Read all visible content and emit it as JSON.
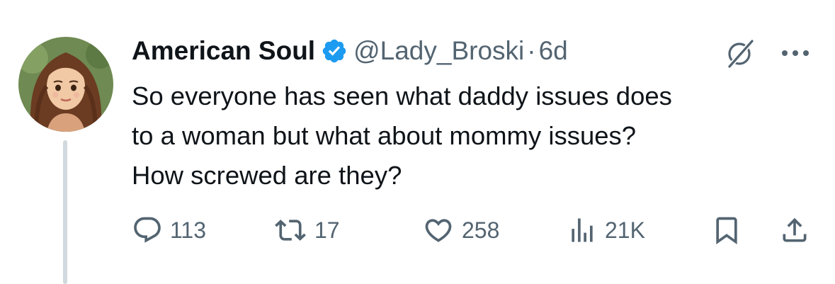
{
  "tweet": {
    "author_name": "American Soul",
    "handle": "@Lady_Broski",
    "separator": "·",
    "time": "6d",
    "text_lines": [
      "So everyone has seen what daddy issues does",
      "to a woman but what about mommy issues?",
      "How screwed are they?"
    ]
  },
  "stats": {
    "replies": "113",
    "reposts": "17",
    "likes": "258",
    "views": "21K"
  },
  "icons": {
    "verified": "verified-badge-icon",
    "grok": "grok-icon",
    "more": "more-options-icon",
    "reply": "reply-icon",
    "repost": "repost-icon",
    "like": "heart-icon",
    "views": "views-icon",
    "bookmark": "bookmark-icon",
    "share": "share-icon"
  },
  "colors": {
    "text": "#0f1419",
    "secondary": "#536471",
    "verified": "#1d9bf0",
    "thread_line": "#cfd9de"
  }
}
